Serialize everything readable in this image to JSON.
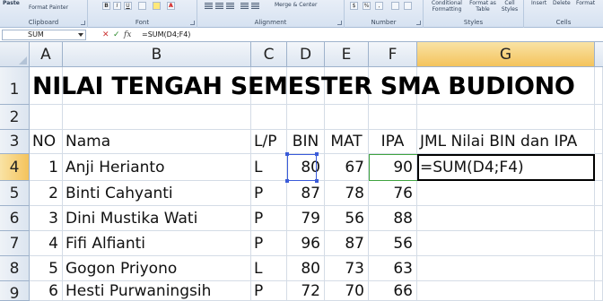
{
  "ribbon": {
    "clipboard": {
      "paste": "Paste",
      "format_painter": "Format Painter",
      "label": "Clipboard"
    },
    "font": {
      "bold": "B",
      "italic": "I",
      "underline": "U",
      "label": "Font"
    },
    "alignment": {
      "merge_center": "Merge & Center",
      "label": "Alignment"
    },
    "number": {
      "currency": "$",
      "percent": "%",
      "comma": ",",
      "label": "Number"
    },
    "styles": {
      "conditional": "Conditional Formatting",
      "format_table": "Format as Table",
      "cell_styles": "Cell Styles",
      "label": "Styles"
    },
    "cells": {
      "insert": "Insert",
      "delete": "Delete",
      "format": "Format",
      "label": "Cells"
    }
  },
  "formula_bar": {
    "name_box": "SUM",
    "cancel": "✕",
    "enter": "✓",
    "fx": "fx",
    "formula": "=SUM(D4;F4)"
  },
  "columns": [
    "A",
    "B",
    "C",
    "D",
    "E",
    "F",
    "G"
  ],
  "selected_column": "G",
  "rows": [
    "1",
    "2",
    "3",
    "4",
    "5",
    "6",
    "7",
    "8",
    "9"
  ],
  "selected_row": "4",
  "sheet": {
    "title": "NILAI TENGAH SEMESTER SMA BUDIONO",
    "headers": {
      "no": "NO",
      "nama": "Nama",
      "lp": "L/P",
      "bin": "BIN",
      "mat": "MAT",
      "ipa": "IPA",
      "jml": "JML Nilai BIN dan IPA"
    },
    "students": [
      {
        "no": "1",
        "nama": "Anji Herianto",
        "lp": "L",
        "bin": "80",
        "mat": "67",
        "ipa": "90",
        "jml": "=SUM(D4;F4)"
      },
      {
        "no": "2",
        "nama": "Binti Cahyanti",
        "lp": "P",
        "bin": "87",
        "mat": "78",
        "ipa": "76",
        "jml": ""
      },
      {
        "no": "3",
        "nama": "Dini Mustika Wati",
        "lp": "P",
        "bin": "79",
        "mat": "56",
        "ipa": "88",
        "jml": ""
      },
      {
        "no": "4",
        "nama": "Fifi Alfianti",
        "lp": "P",
        "bin": "96",
        "mat": "87",
        "ipa": "56",
        "jml": ""
      },
      {
        "no": "5",
        "nama": "Gogon Priyono",
        "lp": "L",
        "bin": "80",
        "mat": "73",
        "ipa": "63",
        "jml": ""
      },
      {
        "no": "6",
        "nama": "Hesti Purwaningsih",
        "lp": "P",
        "bin": "72",
        "mat": "70",
        "ipa": "66",
        "jml": ""
      }
    ]
  },
  "colors": {
    "ref_bin": "#3a5bd9",
    "ref_ipa": "#3fa33f",
    "header_selected": "#f4c35c"
  }
}
